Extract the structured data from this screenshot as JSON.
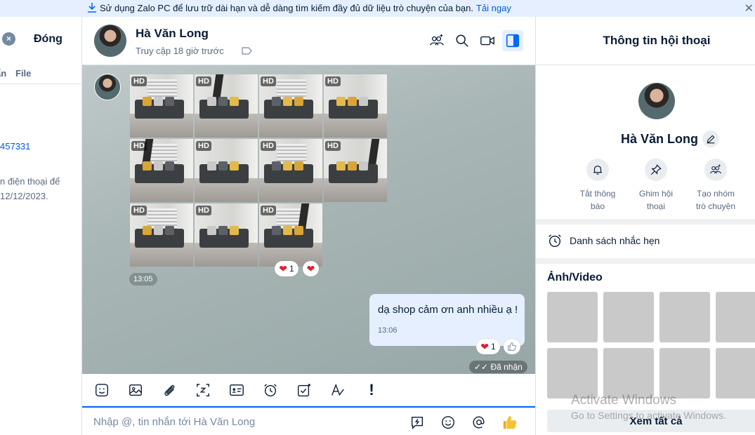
{
  "banner": {
    "icon": "download-icon",
    "text": "Sử dụng Zalo PC để lưu trữ dài hạn và dễ dàng tìm kiếm đầy đủ dữ liệu trò chuyện của bạn.",
    "link": "Tải ngay",
    "close": "✕"
  },
  "left_panel": {
    "close_label": "Đóng",
    "tab_partial": "ẩn",
    "tab_file": "File",
    "phone_partial": "457331",
    "note_line1": "n điện thoại để",
    "note_line2": "12/12/2023."
  },
  "chat_header": {
    "name": "Hà Văn Long",
    "status": "Truy cập 18 giờ trước",
    "icons": [
      "add-group-icon",
      "search-icon",
      "video-call-icon",
      "toggle-sidebar-icon"
    ]
  },
  "messages": {
    "photo_badge": "HD",
    "photo_count": 11,
    "album_time": "13:05",
    "album_reaction_count": "1",
    "my_text": "dạ shop cảm ơn anh nhiều ạ !",
    "my_time": "13:06",
    "my_reaction_count": "1",
    "received_label": "Đã nhận"
  },
  "toolbar": {
    "icons": [
      "sticker-icon",
      "image-icon",
      "attachment-icon",
      "screenshot-icon",
      "contact-card-icon",
      "reminder-icon",
      "todo-icon",
      "text-format-icon",
      "urgent-icon"
    ],
    "urgent_label": "!"
  },
  "composer": {
    "placeholder": "Nhập @, tin nhắn tới Hà Văn Long",
    "icons": [
      "quick-message-icon",
      "emoji-icon",
      "mention-icon",
      "thumbs-up-icon"
    ]
  },
  "right_panel": {
    "title": "Thông tin hội thoại",
    "name": "Hà Văn Long",
    "actions": [
      {
        "line1": "Tắt thông",
        "line2": "báo",
        "icon": "bell-icon"
      },
      {
        "line1": "Ghim hội",
        "line2": "thoại",
        "icon": "pin-icon"
      },
      {
        "line1": "Tạo nhóm",
        "line2": "trò chuyện",
        "icon": "add-group-icon"
      }
    ],
    "reminder_label": "Danh sách nhắc hẹn",
    "media_title": "Ảnh/Video",
    "thumb_count": 8,
    "see_all": "Xem tất cả"
  },
  "watermark": {
    "line1": "Activate Windows",
    "line2": "Go to Settings to activate Windows."
  },
  "colors": {
    "accent": "#0068ff",
    "link": "#005ae0",
    "my_bubble": "#e5efff",
    "text_primary": "#081c36",
    "text_secondary": "#5a6981"
  }
}
